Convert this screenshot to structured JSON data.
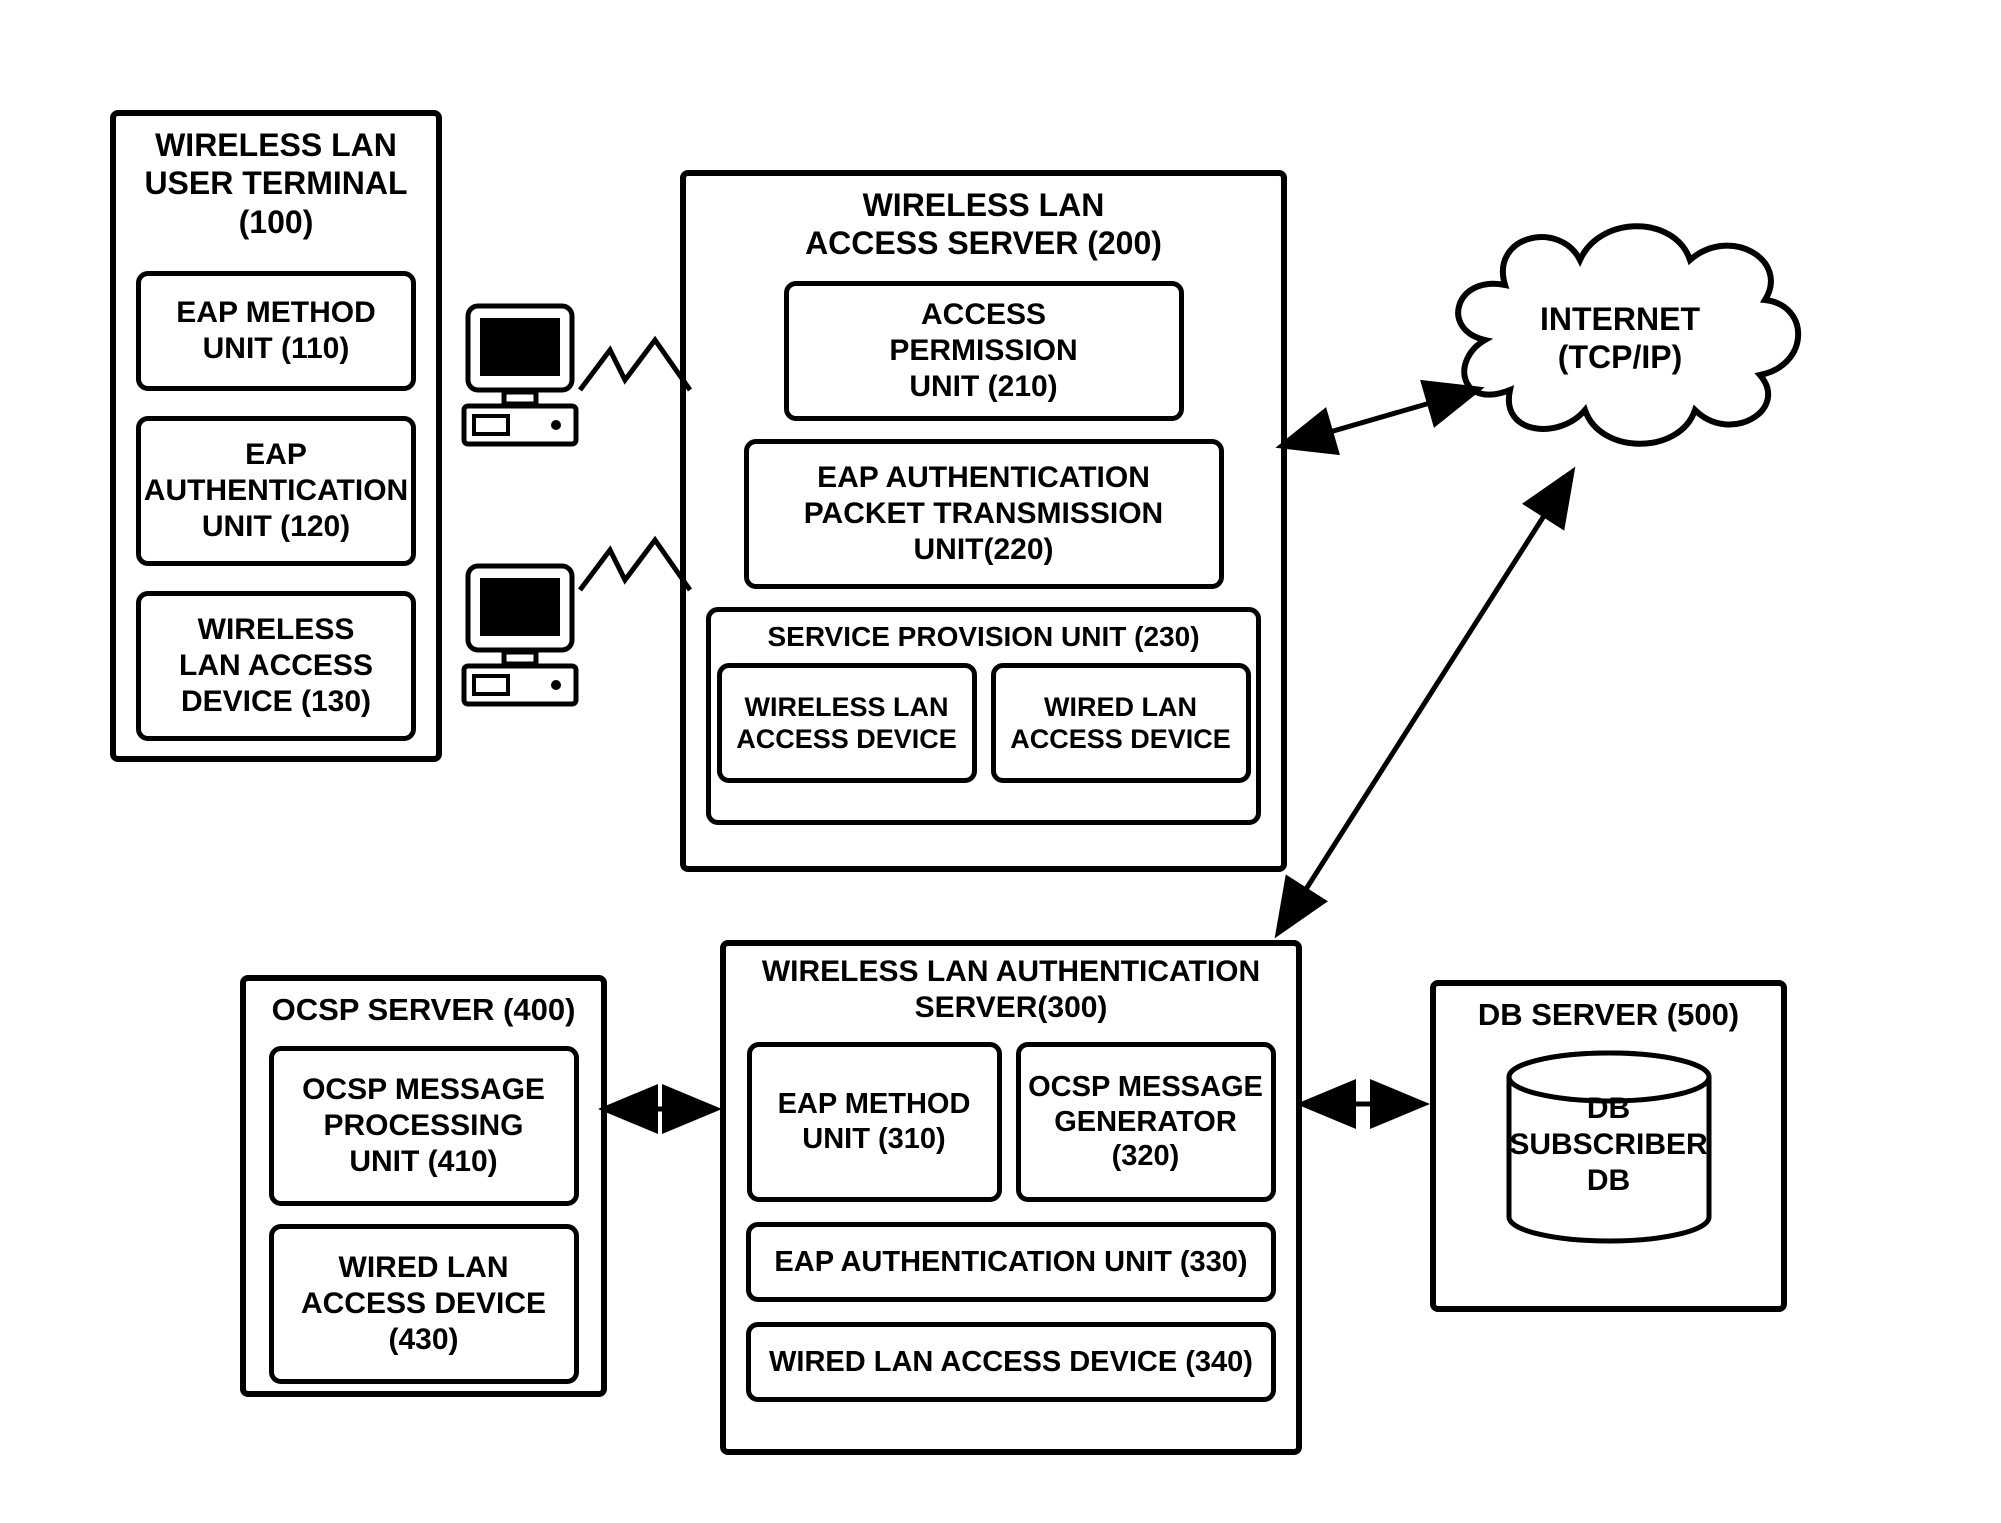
{
  "diagram": {
    "terminal": {
      "title": "WIRELESS LAN\nUSER TERMINAL\n(100)",
      "eap_method": "EAP METHOD\nUNIT (110)",
      "eap_auth": "EAP\nAUTHENTICATION\nUNIT (120)",
      "wlan_device": "WIRELESS\nLAN ACCESS\nDEVICE (130)"
    },
    "access_server": {
      "title": "WIRELESS LAN\nACCESS SERVER (200)",
      "access_permission": "ACCESS\nPERMISSION\nUNIT (210)",
      "eap_pkt_tx": "EAP AUTHENTICATION\nPACKET TRANSMISSION\nUNIT(220)",
      "service_provision": "SERVICE PROVISION UNIT (230)",
      "wlan_dev": "WIRELESS LAN\nACCESS DEVICE",
      "wired_dev": "WIRED LAN\nACCESS DEVICE"
    },
    "internet": "INTERNET\n(TCP/IP)",
    "ocsp": {
      "title": "OCSP SERVER (400)",
      "msg_proc": "OCSP MESSAGE\nPROCESSING\nUNIT (410)",
      "wired_dev": "WIRED LAN\nACCESS DEVICE\n(430)"
    },
    "auth_server": {
      "title": "WIRELESS LAN AUTHENTICATION\nSERVER(300)",
      "eap_method": "EAP METHOD\nUNIT (310)",
      "ocsp_gen": "OCSP MESSAGE\nGENERATOR\n(320)",
      "eap_auth_unit": "EAP AUTHENTICATION UNIT (330)",
      "wired_dev": "WIRED LAN ACCESS DEVICE (340)"
    },
    "db": {
      "title": "DB SERVER (500)",
      "cylinder": "DB\nSUBSCRIBER\nDB"
    }
  }
}
